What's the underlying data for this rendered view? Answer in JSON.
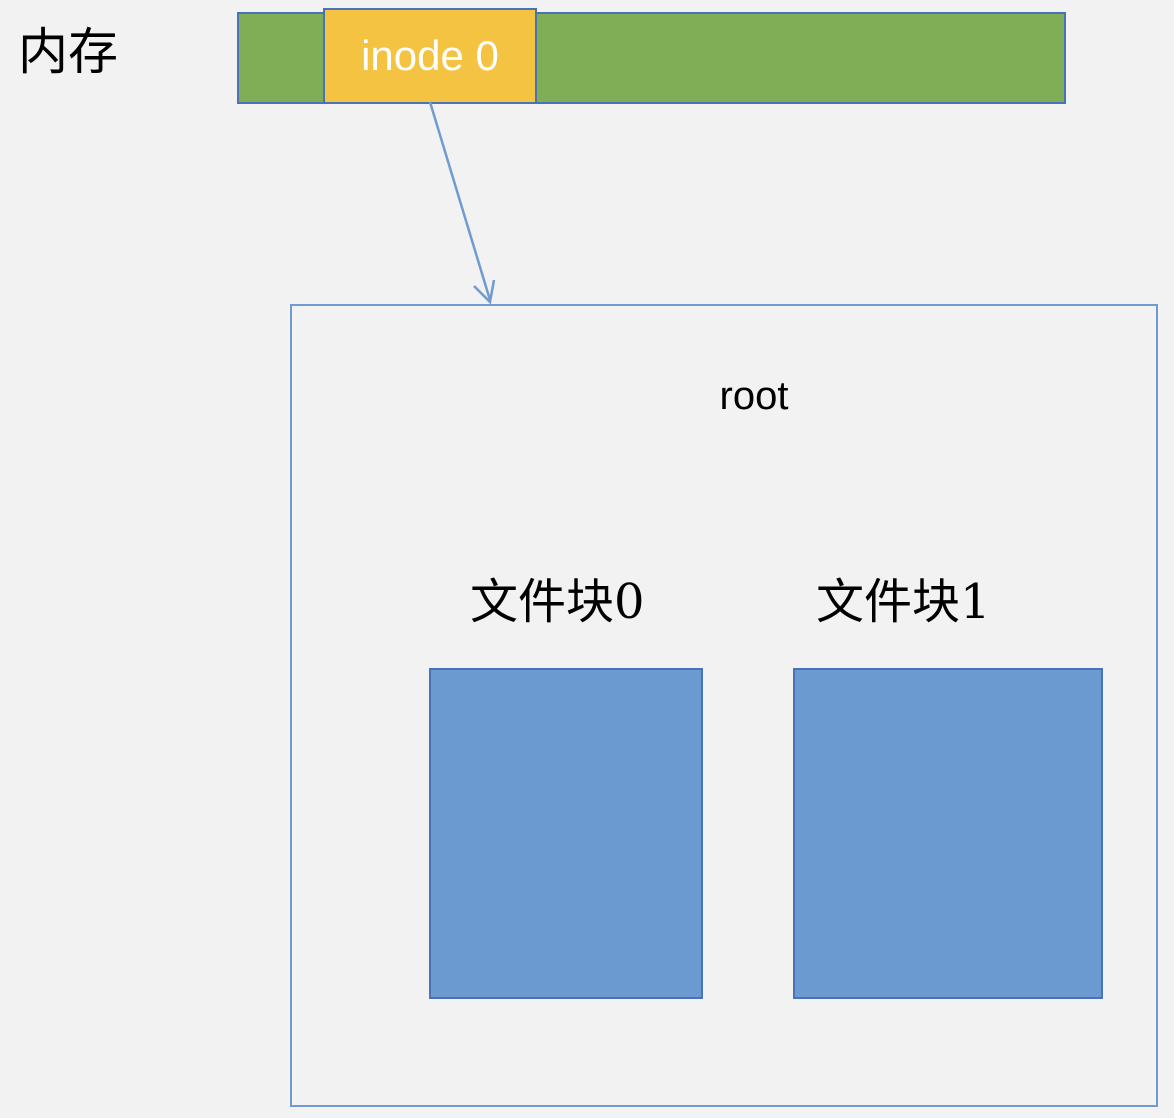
{
  "memory": {
    "label": "内存",
    "inode_label": "inode 0"
  },
  "root": {
    "label": "root",
    "blocks": [
      {
        "label": "文件块0"
      },
      {
        "label": "文件块1"
      }
    ]
  },
  "colors": {
    "background": "#f2f2f2",
    "memory_bar": "#7fae57",
    "inode": "#f5c342",
    "block": "#6a9acf",
    "border": "#4a72b8",
    "arrow": "#6f9bd0"
  }
}
